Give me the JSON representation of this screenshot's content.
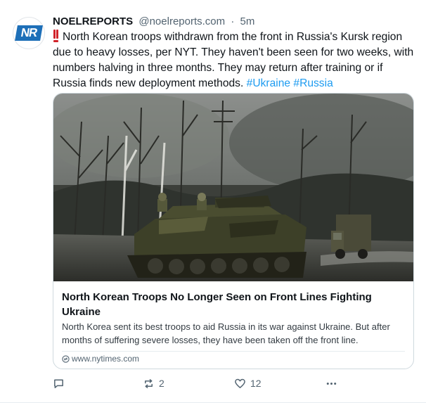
{
  "author": {
    "display_name": "NOELREPORTS",
    "handle": "@noelreports.com",
    "separator": "·",
    "time": "5m",
    "avatar_text": "NR"
  },
  "post": {
    "text": "North Korean troops withdrawn from the front in Russia's Kursk region due to heavy losses, per NYT. They haven't been seen for two weeks, with numbers halving in three months. They may return after training or if Russia finds new deployment methods.",
    "hashtags": [
      "#Ukraine",
      "#Russia"
    ]
  },
  "link_card": {
    "title": "North Korean Troops No Longer Seen on Front Lines Fighting Ukraine",
    "description": "North Korea sent its best troops to aid Russia in its war against Ukraine. But after months of suffering severe losses, they have been taken off the front line.",
    "domain": "www.nytimes.com"
  },
  "actions": {
    "reply_count": "",
    "repost_count": "2",
    "like_count": "12"
  },
  "colors": {
    "accent": "#1d9bf0",
    "secondary_text": "#536471",
    "alert": "#d1232a"
  }
}
